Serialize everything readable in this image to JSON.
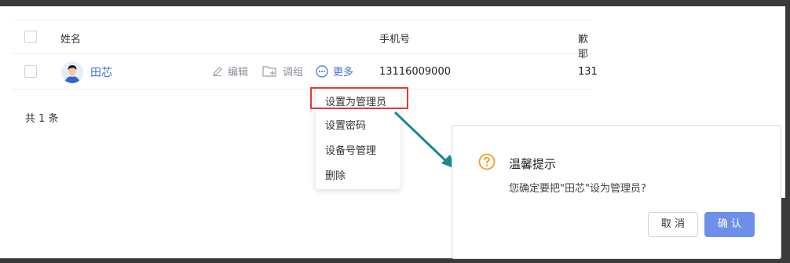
{
  "table": {
    "columns": {
      "name": "姓名",
      "phone": "手机号",
      "clipped": "歉耶"
    },
    "rows": [
      {
        "name": "田芯",
        "actions": {
          "edit": "编辑",
          "group": "调组",
          "more": "更多"
        },
        "phone": "13116009000",
        "clipped": "131"
      }
    ],
    "total": "共 1 条"
  },
  "menu": {
    "items": [
      "设置为管理员",
      "设置密码",
      "设备号管理",
      "删除"
    ]
  },
  "dialog": {
    "title": "温馨提示",
    "message": "您确定要把\"田芯\"设为管理员?",
    "cancel": "取 消",
    "confirm": "确 认"
  },
  "colors": {
    "link": "#3f6fd8",
    "highlight": "#e53935",
    "arrow": "#1a8a8a",
    "warning": "#f0a020",
    "primary": "#6d8fea"
  }
}
